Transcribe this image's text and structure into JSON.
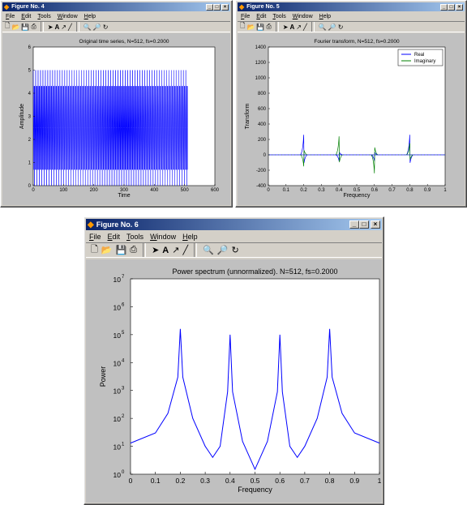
{
  "windows": [
    {
      "id": "fig4",
      "title": "Figure No. 4",
      "menus": [
        "File",
        "Edit",
        "Tools",
        "Window",
        "Help"
      ],
      "plot": {
        "title": "Original time series, N=512, fs=0.2000",
        "xlabel": "Time",
        "ylabel": "Amplitude",
        "xticks": [
          "0",
          "100",
          "200",
          "300",
          "400",
          "500",
          "600"
        ],
        "yticks": [
          "0",
          "1",
          "2",
          "3",
          "4",
          "5",
          "6"
        ]
      }
    },
    {
      "id": "fig5",
      "title": "Figure No. 5",
      "menus": [
        "File",
        "Edit",
        "Tools",
        "Window",
        "Help"
      ],
      "plot": {
        "title": "Fourier transform, N=512, fs=0.2000",
        "xlabel": "Frequency",
        "ylabel": "Transform",
        "xticks": [
          "0",
          "0.1",
          "0.2",
          "0.3",
          "0.4",
          "0.5",
          "0.6",
          "0.7",
          "0.8",
          "0.9",
          "1"
        ],
        "yticks": [
          "-400",
          "-200",
          "0",
          "200",
          "400",
          "600",
          "800",
          "1000",
          "1200",
          "1400"
        ],
        "legend": [
          "Real",
          "Imaginary"
        ]
      }
    },
    {
      "id": "fig6",
      "title": "Figure No. 6",
      "menus": [
        "File",
        "Edit",
        "Tools",
        "Window",
        "Help"
      ],
      "plot": {
        "title": "Power spectrum (unnormalized). N=512, fs=0.2000",
        "xlabel": "Frequency",
        "ylabel": "Power",
        "xticks": [
          "0",
          "0.1",
          "0.2",
          "0.3",
          "0.4",
          "0.5",
          "0.6",
          "0.7",
          "0.8",
          "0.9",
          "1"
        ],
        "yticks": [
          "10",
          "10",
          "10",
          "10",
          "10",
          "10",
          "10",
          "10"
        ],
        "yexp": [
          "0",
          "1",
          "2",
          "3",
          "4",
          "5",
          "6",
          "7"
        ]
      }
    }
  ],
  "colors": {
    "title_bar": "#0a246a",
    "window": "#d4d0c8",
    "figure_bg": "#c0c0c0",
    "series_blue": "#0000ff",
    "series_green": "#008000"
  },
  "chart_data": [
    {
      "type": "line",
      "title": "Original time series, N=512, fs=0.2000",
      "xlabel": "Time",
      "ylabel": "Amplitude",
      "xlim": [
        0,
        600
      ],
      "ylim": [
        0,
        6
      ],
      "series": [
        {
          "x_range": [
            0,
            511
          ],
          "values_cycle": [
            5,
            0.69,
            2.5,
            4.31,
            0,
            4.31,
            2.5,
            0.69
          ]
        }
      ]
    },
    {
      "type": "line",
      "title": "Fourier transform, N=512, fs=0.2000",
      "xlabel": "Frequency",
      "ylabel": "Transform",
      "xlim": [
        0,
        1
      ],
      "ylim": [
        -400,
        1400
      ],
      "legend_position": "top-right",
      "series": [
        {
          "name": "Real",
          "peaks": [
            {
              "x": 0.2,
              "y": 260
            },
            {
              "x": 0.4,
              "y": -80
            },
            {
              "x": 0.6,
              "y": -80
            },
            {
              "x": 0.8,
              "y": 260
            }
          ]
        },
        {
          "name": "Imaginary",
          "peaks": [
            {
              "x": 0.2,
              "y": -150
            },
            {
              "x": 0.4,
              "y": 240
            },
            {
              "x": 0.6,
              "y": -240
            },
            {
              "x": 0.8,
              "y": 150
            }
          ]
        }
      ]
    },
    {
      "type": "line",
      "title": "Power spectrum (unnormalized). N=512, fs=0.2000",
      "xlabel": "Frequency",
      "ylabel": "Power",
      "xlim": [
        0,
        1
      ],
      "ylim": [
        1,
        10000000
      ],
      "yscale": "log",
      "series": [
        {
          "x": [
            0,
            0.1,
            0.15,
            0.19,
            0.2,
            0.21,
            0.25,
            0.3,
            0.33,
            0.36,
            0.39,
            0.4,
            0.41,
            0.45,
            0.5,
            0.55,
            0.59,
            0.6,
            0.61,
            0.64,
            0.67,
            0.7,
            0.75,
            0.79,
            0.8,
            0.81,
            0.85,
            0.9,
            1.0
          ],
          "y": [
            13,
            30,
            150,
            3000,
            160000,
            3000,
            100,
            10,
            4,
            10,
            900,
            100000,
            900,
            15,
            1.5,
            15,
            900,
            100000,
            900,
            10,
            4,
            10,
            100,
            3000,
            160000,
            3000,
            150,
            30,
            13
          ]
        }
      ]
    }
  ]
}
